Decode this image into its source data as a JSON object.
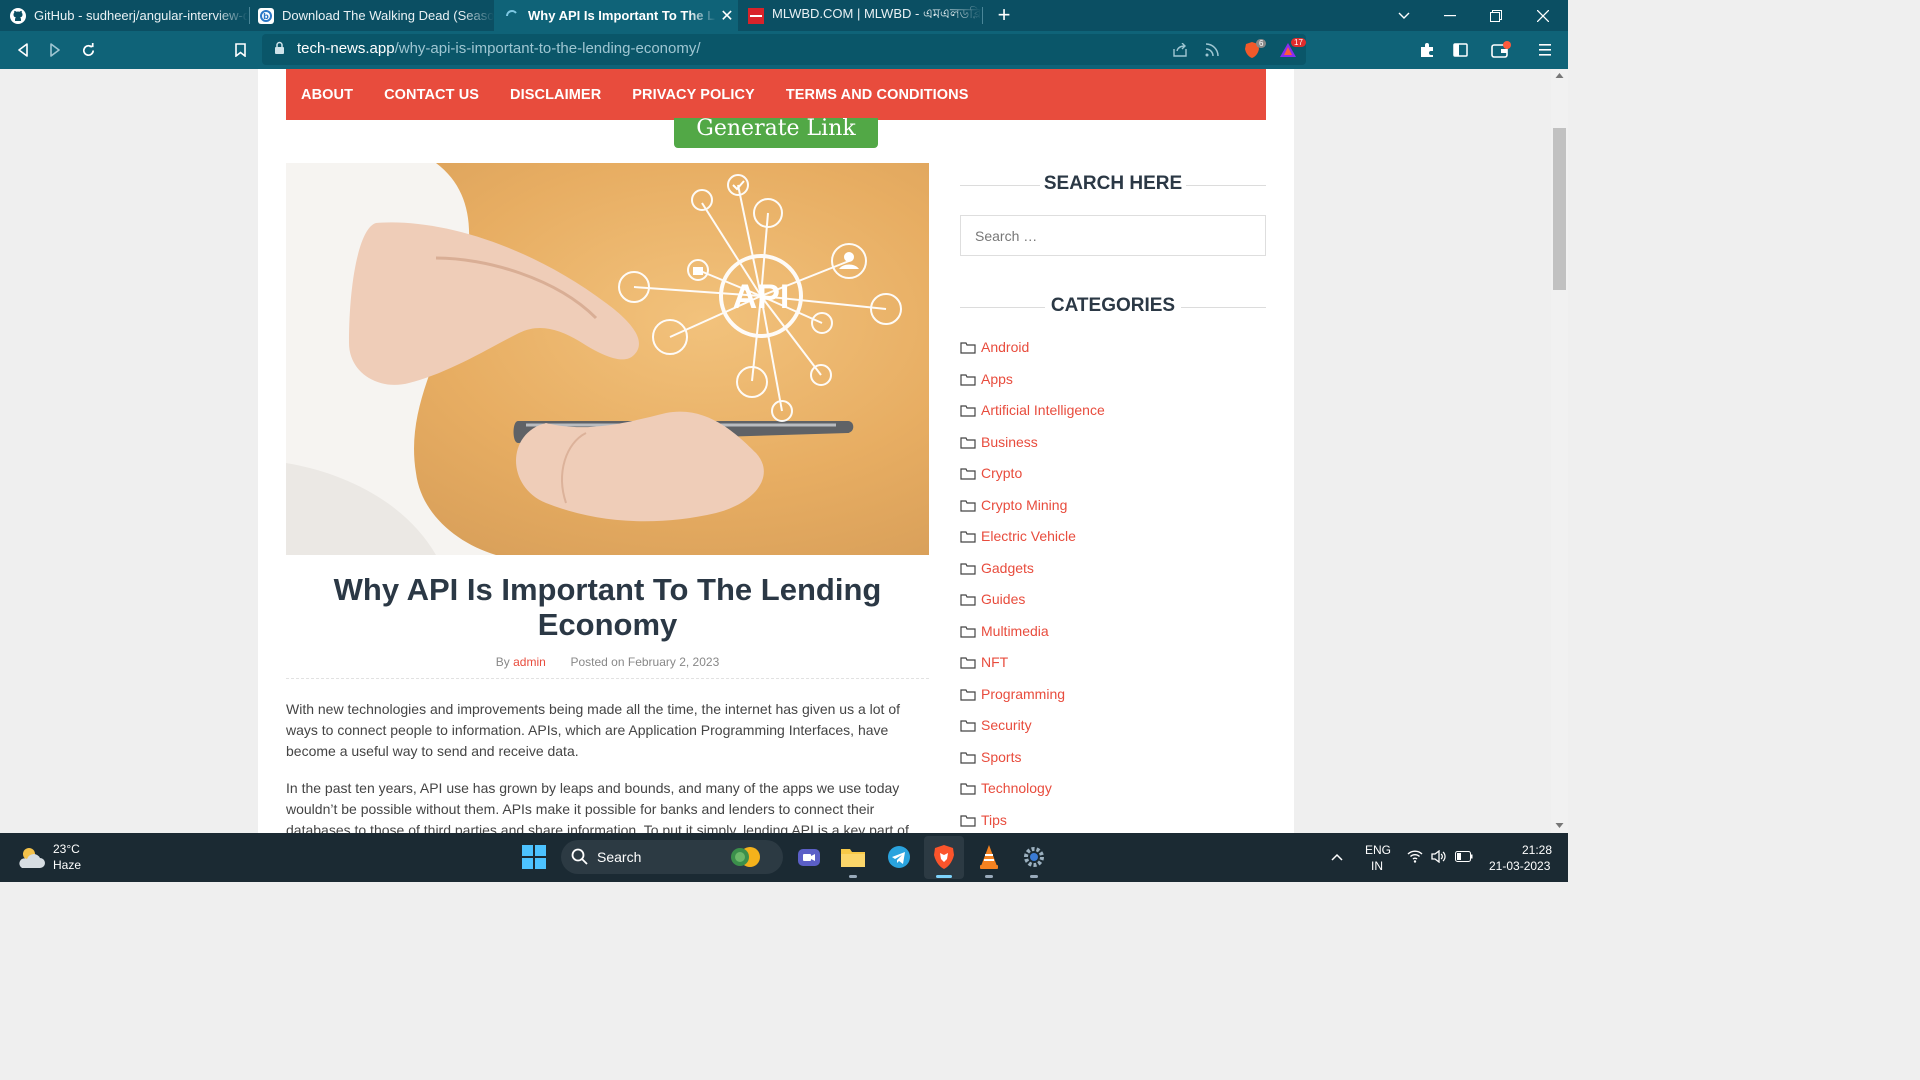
{
  "browser": {
    "tabs": [
      {
        "title": "GitHub - sudheerj/angular-interview-q",
        "icon": "github-icon",
        "active": false
      },
      {
        "title": "Download The Walking Dead (Season",
        "icon": "site-b-icon",
        "active": false
      },
      {
        "title": "Why API Is Important To The Lend",
        "icon": "loading-icon",
        "active": true
      },
      {
        "title": "MLWBD.COM | MLWBD - এমএলডব্লিউ",
        "icon": "mlwbd-icon",
        "active": false
      }
    ],
    "new_tab_label": "+",
    "address": {
      "domain": "tech-news.app",
      "path": "/why-api-is-important-to-the-lending-economy/"
    },
    "shields_badge": "6",
    "rewards_badge": "17"
  },
  "site": {
    "nav": [
      "ABOUT",
      "CONTACT US",
      "DISCLAIMER",
      "PRIVACY POLICY",
      "TERMS AND CONDITIONS"
    ],
    "generate_link": "Generate Link"
  },
  "hero": {
    "center_label": "API"
  },
  "article": {
    "title": "Why API Is Important To The Lending Economy",
    "by": "By",
    "author": "admin",
    "posted": "Posted on February 2, 2023",
    "paragraphs": [
      "With new technologies and improvements being made all the time, the internet has given us a lot of ways to connect people to information. APIs, which are Application Programming Interfaces, have become a useful way to send and receive data.",
      "In the past ten years, API use has grown by leaps and bounds, and many of the apps we use today wouldn’t be possible without them. APIs make it possible for banks and lenders to connect their databases to those of third parties and share information. To put it simply, lending API is a key part of the lending economy."
    ]
  },
  "sidebar": {
    "search_title": "SEARCH HERE",
    "search_placeholder": "Search …",
    "categories_title": "CATEGORIES",
    "categories": [
      "Android",
      "Apps",
      "Artificial Intelligence",
      "Business",
      "Crypto",
      "Crypto Mining",
      "Electric Vehicle",
      "Gadgets",
      "Guides",
      "Multimedia",
      "NFT",
      "Programming",
      "Security",
      "Sports",
      "Technology",
      "Tips"
    ]
  },
  "taskbar": {
    "weather_temp": "23°C",
    "weather_desc": "Haze",
    "search_label": "Search",
    "lang_top": "ENG",
    "lang_bottom": "IN",
    "time": "21:28",
    "date": "21-03-2023"
  },
  "colors": {
    "brand_red": "#e84c3d",
    "chrome_teal": "#0f6378",
    "generate_green": "#52a846"
  }
}
